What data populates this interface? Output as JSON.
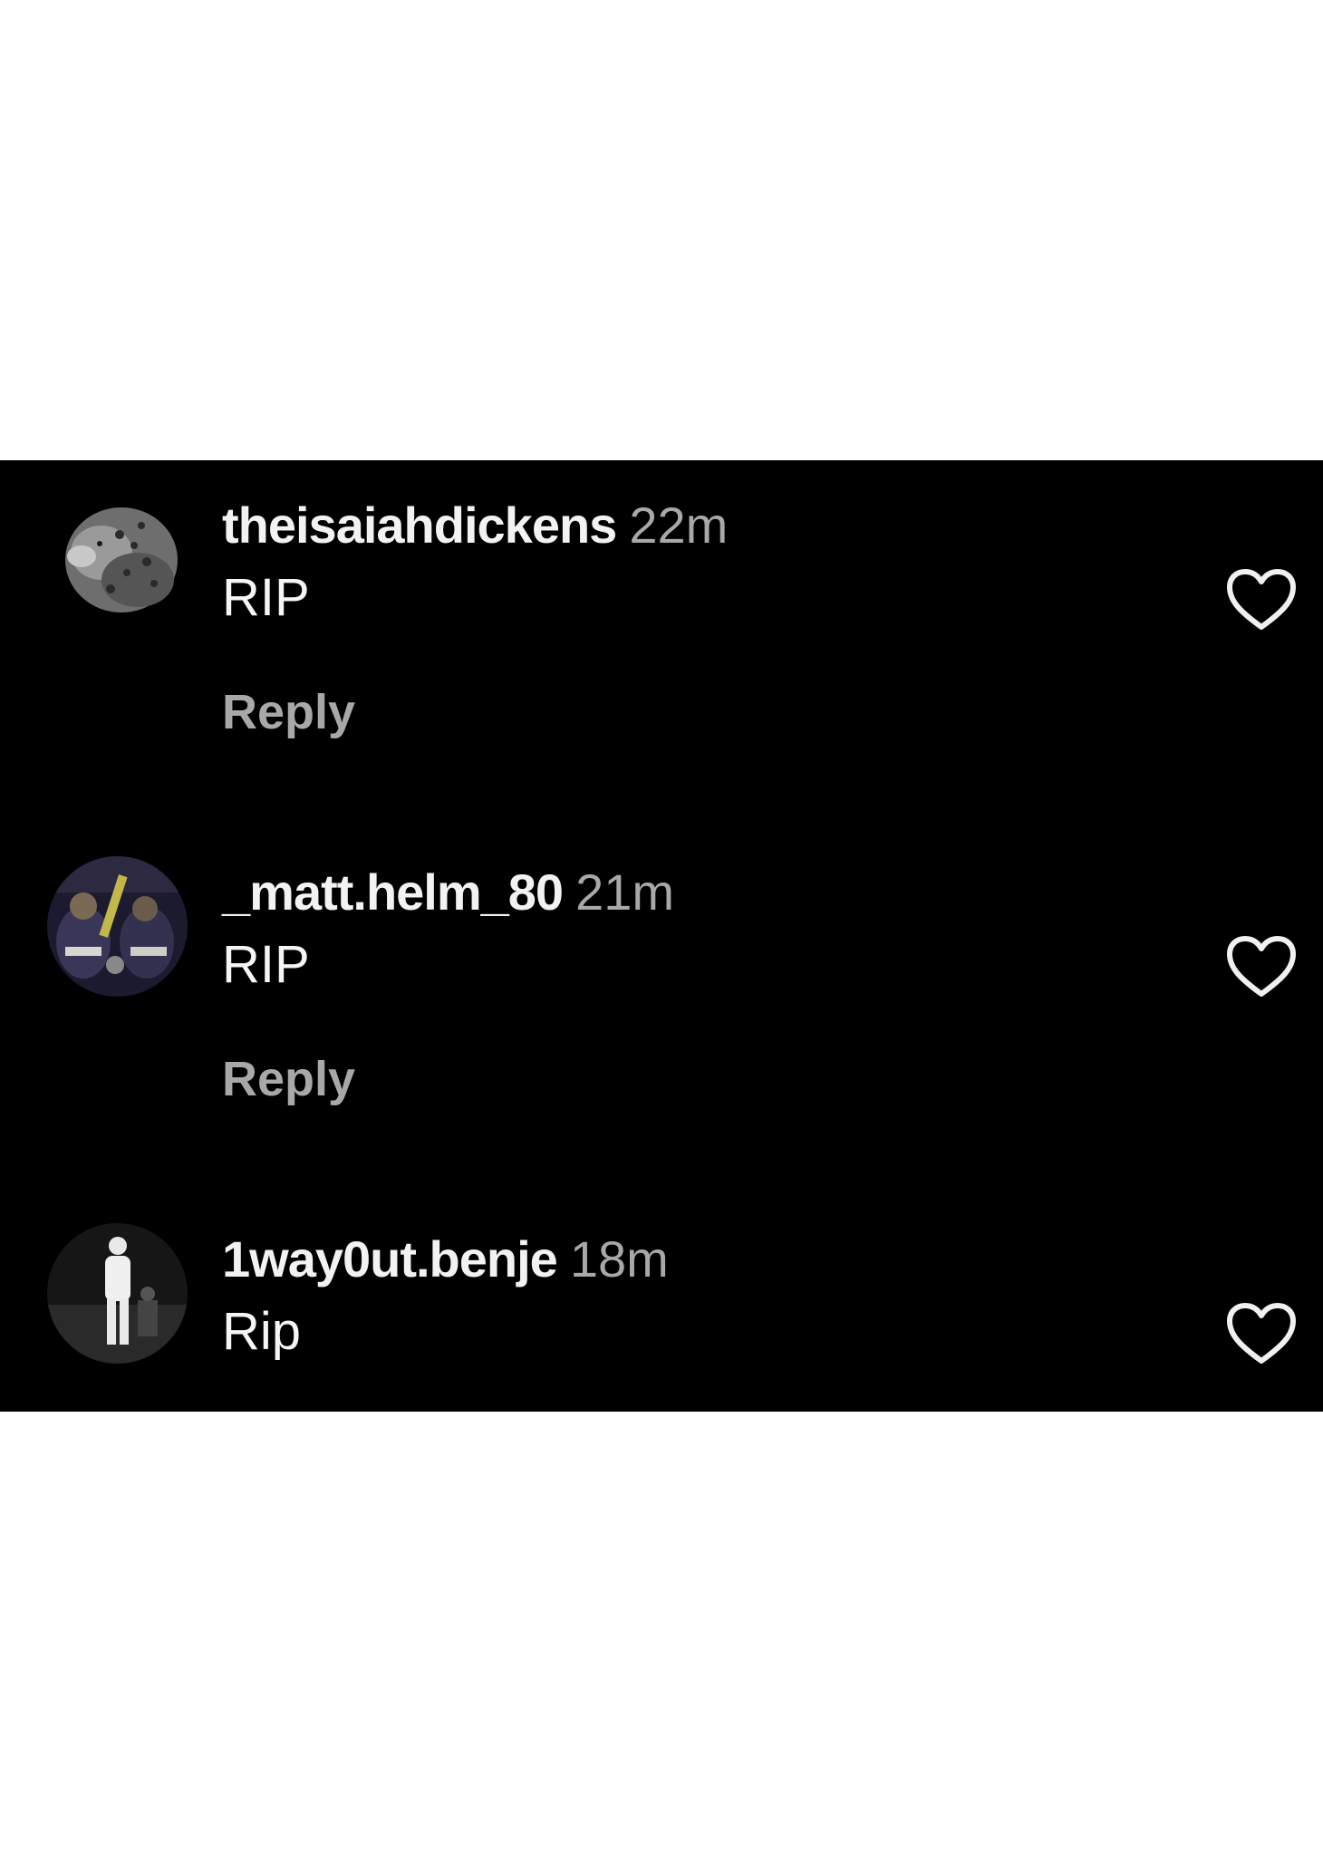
{
  "comments": [
    {
      "username": "theisaiahdickens",
      "time": "22m",
      "text": "RIP",
      "reply_label": "Reply",
      "avatar_icon": "leopard-avatar",
      "like_icon": "heart-outline-icon"
    },
    {
      "username": "_matt.helm_80",
      "time": "21m",
      "text": "RIP",
      "reply_label": "Reply",
      "avatar_icon": "team-photo-avatar",
      "like_icon": "heart-outline-icon"
    },
    {
      "username": "1way0ut.benje",
      "time": "18m",
      "text": "Rip",
      "avatar_icon": "person-photo-avatar",
      "like_icon": "heart-outline-icon"
    }
  ],
  "colors": {
    "background": "#000000",
    "username": "#f2f2f2",
    "secondary_text": "#a8a8a8",
    "page": "#ffffff"
  }
}
